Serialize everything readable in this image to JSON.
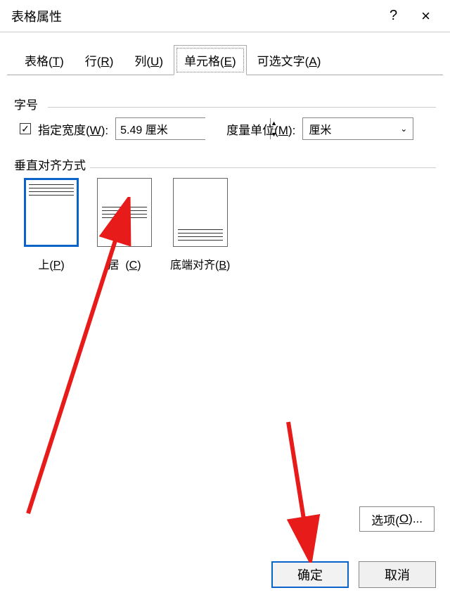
{
  "titlebar": {
    "title": "表格属性",
    "help": "?",
    "close": "×"
  },
  "tabs": {
    "table": "表格(T)",
    "row": "行(R)",
    "column": "列(U)",
    "cell": "单元格(E)",
    "alttext": "可选文字(A)"
  },
  "size": {
    "group_label": "字号",
    "width_check_label": "指定宽度(W):",
    "width_value": "5.49 厘米",
    "unit_label": "度量单位(M):",
    "unit_value": "厘米"
  },
  "valign": {
    "group_label": "垂直对齐方式",
    "top": "上(P)",
    "center": "居   (C)",
    "bottom": "底端对齐(B)"
  },
  "buttons": {
    "options": "选项(O)...",
    "ok": "确定",
    "cancel": "取消"
  }
}
